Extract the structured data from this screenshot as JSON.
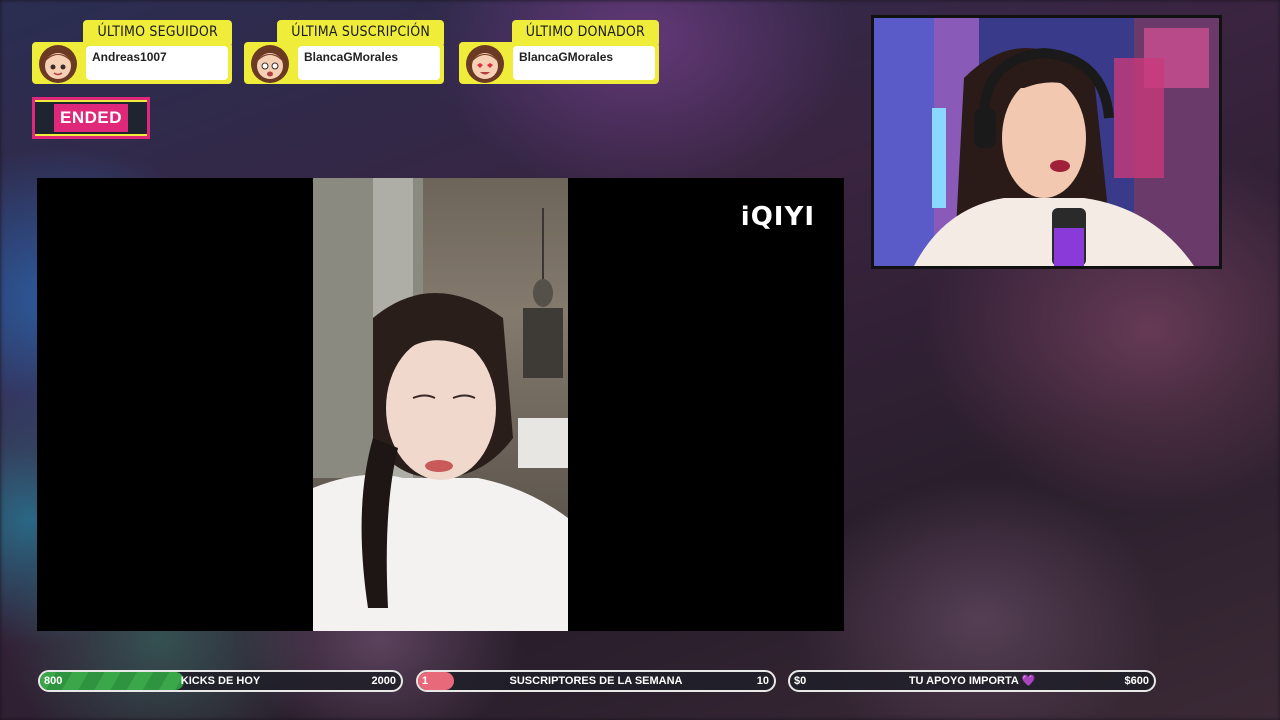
{
  "alerts": [
    {
      "label": "ÚLTIMO SEGUIDOR",
      "name": "Andreas1007"
    },
    {
      "label": "ÚLTIMA SUSCRIPCIÓN",
      "name": "BlancaGMorales"
    },
    {
      "label": "ÚLTIMO DONADOR",
      "name": "BlancaGMorales"
    }
  ],
  "status_badge": "ENDED",
  "video": {
    "watermark": "iQIYI"
  },
  "bars": [
    {
      "left": "800",
      "label": "KICKS DE HOY",
      "right": "2000",
      "progress": 0.4,
      "color": "#3aa84a"
    },
    {
      "left": "1",
      "label": "SUSCRIPTORES DE LA SEMANA",
      "right": "10",
      "progress": 0.1,
      "color": "#e86a7a"
    },
    {
      "left": "$0",
      "label": "TU APOYO IMPORTA 💜",
      "right": "$600",
      "progress": 0.0,
      "color": "#9a5ad0"
    }
  ],
  "colors": {
    "accent_yellow": "#f0ec3a",
    "accent_pink": "#e0287a"
  }
}
